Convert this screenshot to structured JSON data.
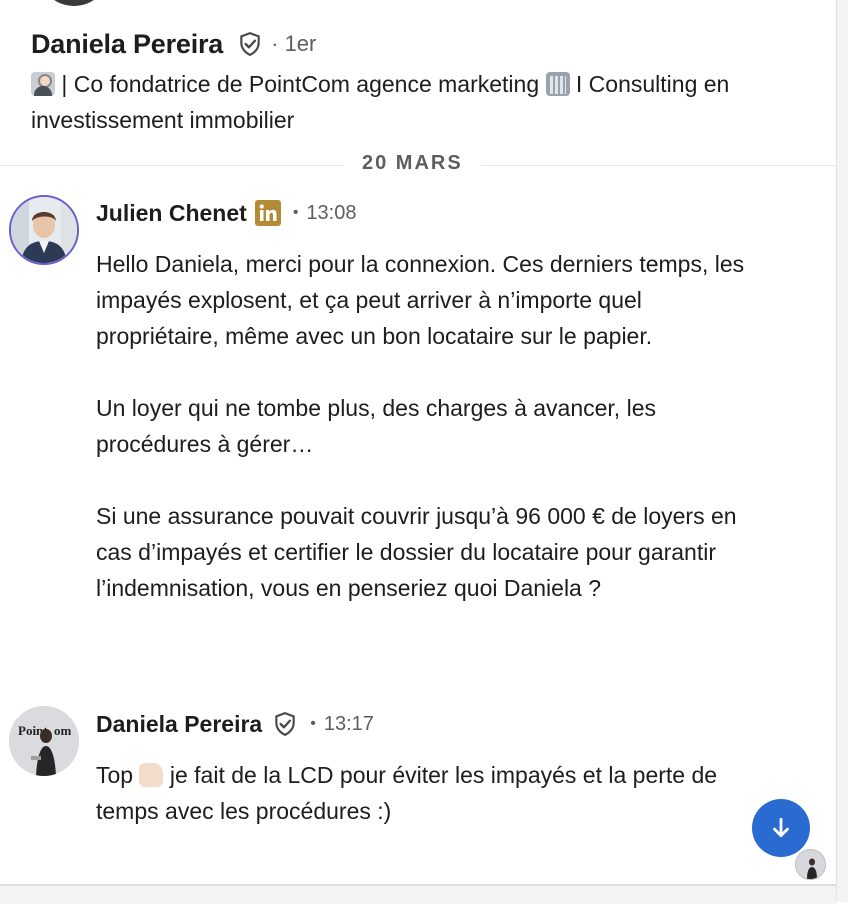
{
  "header": {
    "name": "Daniela Pereira",
    "degree": "· 1er",
    "headline_part1": "| Co fondatrice de PointCom agence marketing",
    "headline_part2": "I Consulting en investissement immobilier",
    "verified_icon": "verified-shield-icon"
  },
  "date_separator": "20 MARS",
  "messages": [
    {
      "sender": "Julien Chenet",
      "time": "13:08",
      "badge_icon": "linkedin-icon",
      "paragraphs": [
        "Hello Daniela, merci pour la connexion. Ces derniers temps, les impayés explosent, et ça peut arriver à n’importe quel propriétaire, même avec un bon locataire sur le papier.",
        "Un loyer qui ne tombe plus, des charges à avancer, les procédures à gérer…",
        "Si une assurance pouvait couvrir jusqu’à 96 000 € de loyers en cas d’impayés et certifier le dossier du locataire pour garantir l’indemnisation, vous en penseriez quoi Daniela ?"
      ]
    },
    {
      "sender": "Daniela Pereira",
      "time": "13:17",
      "badge_icon": "verified-shield-icon",
      "text_before_emoji": "Top",
      "text_after_emoji": "je fait de la LCD pour éviter les impayés et la perte de temps avec les procédures :)"
    }
  ],
  "colors": {
    "accent_blue": "#2a6bd1",
    "linkedin_badge": "#b28b34",
    "text_primary": "#1d1d1d",
    "text_secondary": "#5e5e5e"
  }
}
